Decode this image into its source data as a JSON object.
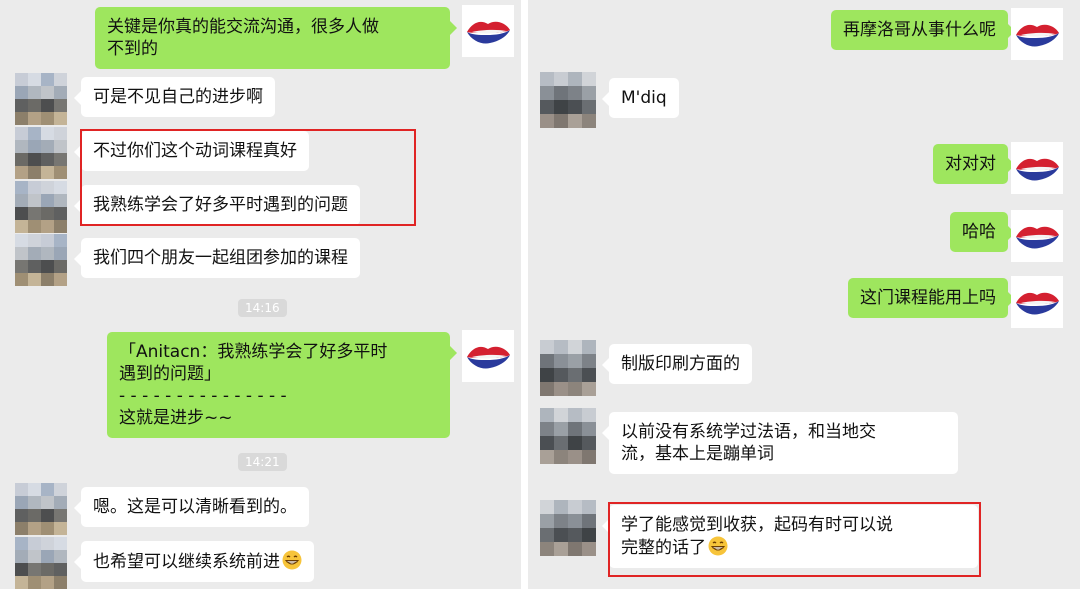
{
  "left": {
    "messages": [
      {
        "text": "关键是你真的能交流沟通，很多人做\n不到的"
      },
      {
        "text": "可是不见自己的进步啊"
      },
      {
        "text": "不过你们这个动词课程真好"
      },
      {
        "text": "我熟练学会了好多平时遇到的问题"
      },
      {
        "text": "我们四个朋友一起组团参加的课程"
      },
      {
        "text": "「Anitacn：我熟练学会了好多平时\n遇到的问题」\n- - - - - - - - - - - - - - -\n这就是进步~~"
      },
      {
        "text": "嗯。这是可以清晰看到的。"
      },
      {
        "text": "也希望可以继续系统前进"
      }
    ],
    "times": [
      "14:16",
      "14:21"
    ]
  },
  "right": {
    "messages": [
      {
        "text": "再摩洛哥从事什么呢"
      },
      {
        "text": "M'diq"
      },
      {
        "text": "对对对"
      },
      {
        "text": "哈哈"
      },
      {
        "text": "这门课程能用上吗"
      },
      {
        "text": "制版印刷方面的"
      },
      {
        "text": "以前没有系统学过法语，和当地交\n流，基本上是蹦单词"
      },
      {
        "text": "学了能感觉到收获，起码有时可以说\n完整的话了"
      }
    ]
  },
  "colors": {
    "outgoing": "#9ee65e",
    "incoming": "#ffffff",
    "highlight": "#e02424",
    "background": "#ebebeb"
  },
  "icons": {
    "emoji": "grinning-face-emoji",
    "own_avatar": "lips-icon"
  }
}
